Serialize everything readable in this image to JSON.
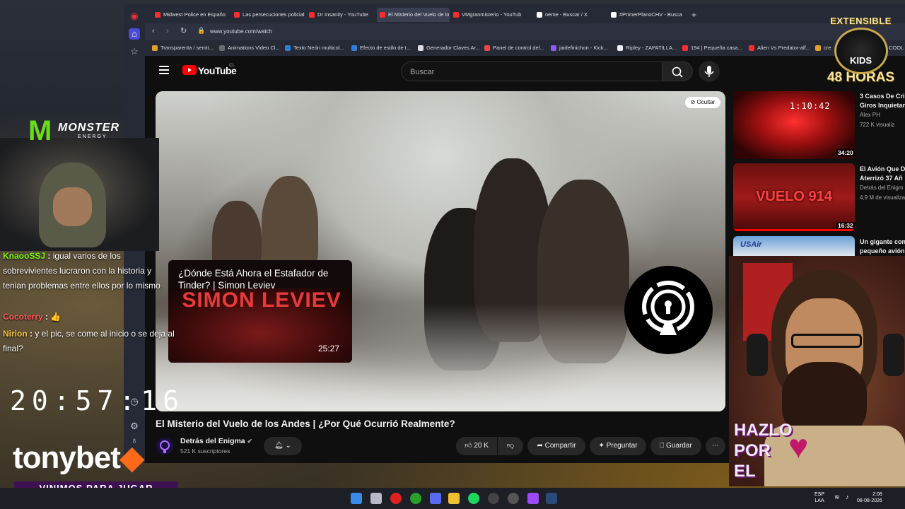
{
  "browser": {
    "tabs": [
      {
        "label": "Midwest Police en Españo",
        "color": "#ff2a2a",
        "active": false
      },
      {
        "label": "Las persecuciones policial",
        "color": "#ff2a2a",
        "active": false
      },
      {
        "label": "Dr Insanity - YouTube",
        "color": "#ff2a2a",
        "active": false
      },
      {
        "label": "El Misterio del Vuelo de lo",
        "color": "#ff2a2a",
        "active": true
      },
      {
        "label": "VMgranmisterio - YouTub",
        "color": "#ff2a2a",
        "active": false
      },
      {
        "label": "neme - Buscar / X",
        "color": "#ffffff",
        "active": false
      },
      {
        "label": "#PrimerPlanoCHV - Busca",
        "color": "#ffffff",
        "active": false
      }
    ],
    "url": "www.youtube.com/watch",
    "bookmarks": [
      {
        "label": "Transparenta / semit...",
        "color": "#e0a030"
      },
      {
        "label": "Animations Video Cl...",
        "color": "#6b6b6b"
      },
      {
        "label": "Texto Neón multicol...",
        "color": "#2f7fd8"
      },
      {
        "label": "Efecto de estilo de t...",
        "color": "#2f7fd8"
      },
      {
        "label": "Generador Claves Ar...",
        "color": "#dddddd"
      },
      {
        "label": "Panel de control del...",
        "color": "#e84a4a"
      },
      {
        "label": "jaidefinichon - Kick...",
        "color": "#8a5cf6"
      },
      {
        "label": "Ripley - ZAPATILLA...",
        "color": "#eeeeee"
      },
      {
        "label": "194 | Pequeña casa...",
        "color": "#ff2a2a"
      },
      {
        "label": "Alien Vs Predator-alf...",
        "color": "#ff2a2a"
      },
      {
        "label": "cre",
        "color": "#e0a030"
      },
      {
        "label": "COOL",
        "color": "#dddddd"
      }
    ]
  },
  "youtube": {
    "logo_text": "YouTube",
    "logo_country": "CL",
    "search_placeholder": "Buscar",
    "hide_label": "Ocultar",
    "video_title": "El Misterio del Vuelo de los Andes | ¿Por Qué Ocurrió Realmente?",
    "channel_name": "Detrás del Enigma",
    "subscribers": "521 K suscriptores",
    "likes": "20 K",
    "share_label": "Compartir",
    "ask_label": "Preguntar",
    "save_label": "Guardar",
    "overlay_card": {
      "title": "¿Dónde Está Ahora el Estafador de Tinder? | Simon Leviev",
      "thumb_text": "SIMON LEVIEV",
      "duration": "25:27"
    },
    "recommendations": [
      {
        "title1": "3 Casos De Cri",
        "title2": "Giros Inquietan",
        "channel": "Alex PH",
        "views": "722 K visualiz",
        "duration": "34:20",
        "thumb_timestamp": "1:10:42"
      },
      {
        "title1": "El Avión Que D",
        "title2": "Aterrizó 37 Añ",
        "channel": "Detrás del Enigm",
        "views": "4,9 M de visualiza",
        "duration": "16:32",
        "thumb_text": "VUELO 914"
      },
      {
        "title1": "Un gigante con",
        "title2": "pequeño avión",
        "channel": "",
        "views": "",
        "duration": "",
        "thumb_text": "USAir"
      }
    ]
  },
  "stream": {
    "chat": [
      {
        "user": "KnaooSSJ",
        "user_color": "#7cfc00",
        "text": "igual varios de los sobrevivientes lucraron con la historia y tenian problemas entre ellos por lo mismo"
      },
      {
        "user": "Cocoterry",
        "user_color": "#ff5a5a",
        "text": "👍"
      },
      {
        "user": "Nirion",
        "user_color": "#f5c542",
        "text": "y el pic, se come al inicio o se deja al final?"
      }
    ],
    "clock": "20:57:16",
    "sponsor_name": "tonybet",
    "sponsor_tagline": "VINIMOS PARA JUGAR",
    "brand_logo": "MONSTER",
    "brand_sub": "ENERGY",
    "extensible_top": "EXTENSIBLE",
    "extensible_kids": "KIDS",
    "extensible_hours": "48 HORAS",
    "hazlo_text": "HAZLO POR EL"
  },
  "taskbar": {
    "lang": "ESP",
    "lang_sub": "LAA",
    "time": "2:08",
    "date": "08-08-2026"
  }
}
